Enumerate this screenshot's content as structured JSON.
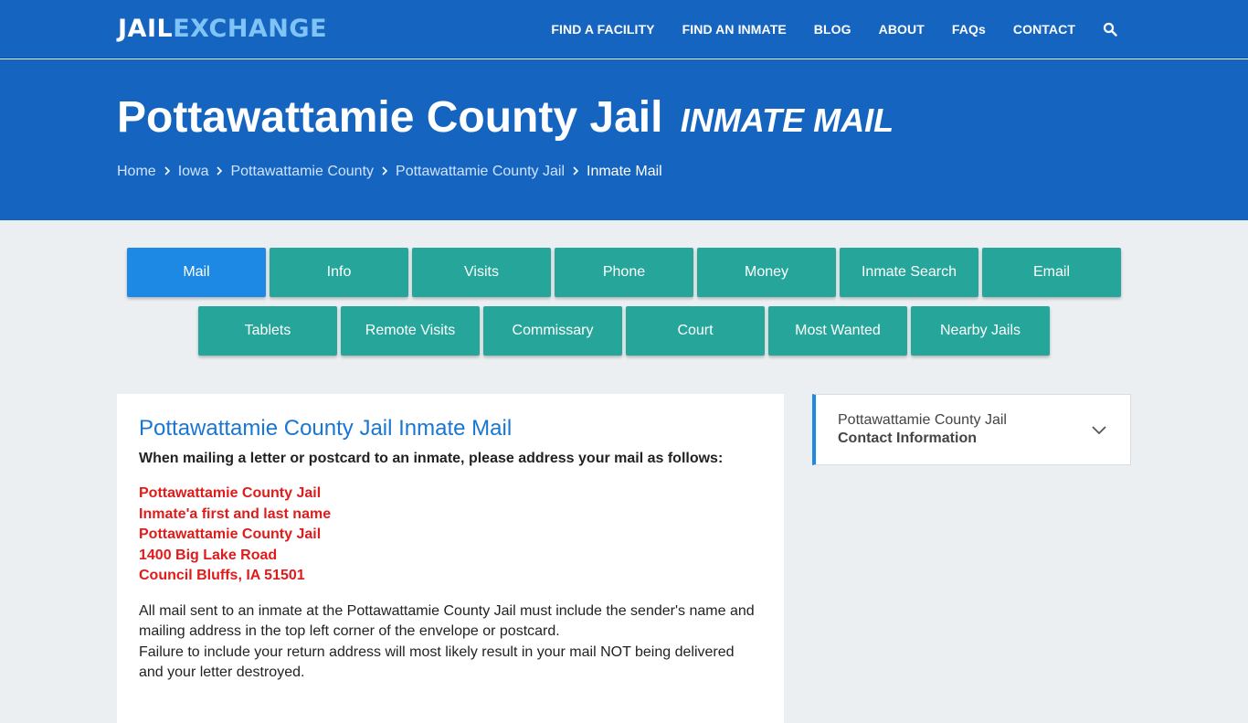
{
  "logo": {
    "part1": "JAIL",
    "part2": "EXCHANGE"
  },
  "nav": [
    "FIND A FACILITY",
    "FIND AN INMATE",
    "BLOG",
    "ABOUT",
    "FAQs",
    "CONTACT"
  ],
  "hero": {
    "title": "Pottawattamie County Jail",
    "subtitle": "INMATE MAIL",
    "breadcrumbs": [
      "Home",
      "Iowa",
      "Pottawattamie County",
      "Pottawattamie County Jail"
    ],
    "current": "Inmate Mail"
  },
  "tabs_row1": [
    "Mail",
    "Info",
    "Visits",
    "Phone",
    "Money",
    "Inmate Search",
    "Email"
  ],
  "tabs_row2": [
    "Tablets",
    "Remote Visits",
    "Commissary",
    "Court",
    "Most Wanted",
    "Nearby Jails"
  ],
  "content": {
    "heading": "Pottawattamie County Jail Inmate Mail",
    "lead": "When mailing a letter or postcard to an inmate, please address your mail as follows:",
    "address": [
      "Pottawattamie County Jail",
      "Inmate'a first and last name",
      "Pottawattamie County Jail",
      "1400 Big Lake Road",
      "Council Bluffs, IA 51501"
    ],
    "para1": "All mail sent to an inmate at the Pottawattamie County Jail must include the sender's name and mailing address in the top left corner of the envelope or postcard.",
    "para2": "Failure to include your return address will most likely result in your mail NOT being delivered and your letter destroyed."
  },
  "sidebar": {
    "line1": "Pottawattamie County Jail",
    "line2": "Contact Information"
  },
  "colors": {
    "header": "#1565c0",
    "tab": "#26a69a",
    "tab_active": "#1e88e5",
    "address": "#e01b1b"
  }
}
